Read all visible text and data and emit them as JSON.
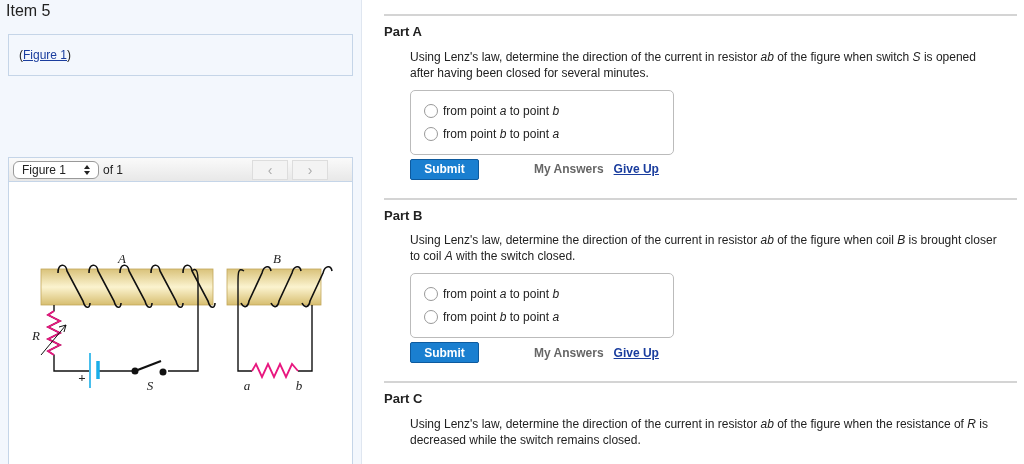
{
  "item_title": "Item 5",
  "figure_link": {
    "before": "(",
    "link": "Figure 1",
    "after": ")"
  },
  "figure_viewer": {
    "select_value": "Figure 1",
    "of_text": "of 1",
    "prev": "‹",
    "next": "›",
    "labels": [
      "A",
      "B",
      "R",
      "S",
      "a",
      "b",
      "+"
    ]
  },
  "parts": [
    {
      "title": "Part A",
      "question": "Using Lenz's law, determine the direction of the current in resistor *ab* of the figure when switch *S* is opened after having been closed for several minutes.",
      "options": [
        {
          "label": "from point *a* to point *b*",
          "selected": false
        },
        {
          "label": "from point *b* to point *a*",
          "selected": false
        }
      ],
      "submit": "Submit",
      "my_answers": "My Answers",
      "give_up": "Give Up"
    },
    {
      "title": "Part B",
      "question": "Using Lenz's law, determine the direction of the current in resistor *ab* of the figure when coil *B* is brought closer to coil *A* with the switch closed.",
      "options": [
        {
          "label": "from point *a* to point *b*",
          "selected": false
        },
        {
          "label": "from point *b* to point *a*",
          "selected": false
        }
      ],
      "submit": "Submit",
      "my_answers": "My Answers",
      "give_up": "Give Up"
    },
    {
      "title": "Part C",
      "question": "Using Lenz's law, determine the direction of the current in resistor *ab* of the figure when the resistance of *R* is decreased while the switch remains closed."
    }
  ]
}
